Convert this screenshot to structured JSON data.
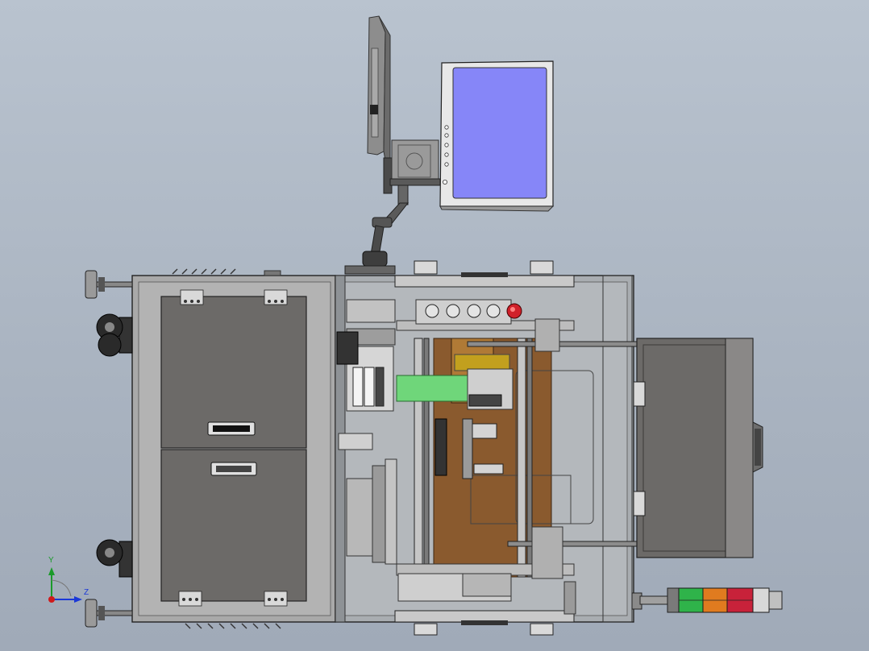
{
  "viewport": {
    "triad": {
      "y_label": "Y",
      "z_label": "Z"
    }
  },
  "colors": {
    "background": "#aab4c1",
    "screen": "#8a86f6",
    "frame": "#a8a8a8",
    "panel_dark": "#6c6a68",
    "carrier_green": "#6fd67a",
    "plate_brown": "#8a5a2e",
    "tower_green": "#2fb34a",
    "tower_orange": "#e07b1f",
    "tower_red": "#c8223a",
    "estop_red": "#d0202a"
  },
  "icons": [
    "monitor-screen",
    "articulated-monitor-arm",
    "leveling-foot",
    "caster-wheel",
    "drawer-handle",
    "hinge",
    "signal-tower-light",
    "emergency-stop-button",
    "coordinate-triad"
  ]
}
